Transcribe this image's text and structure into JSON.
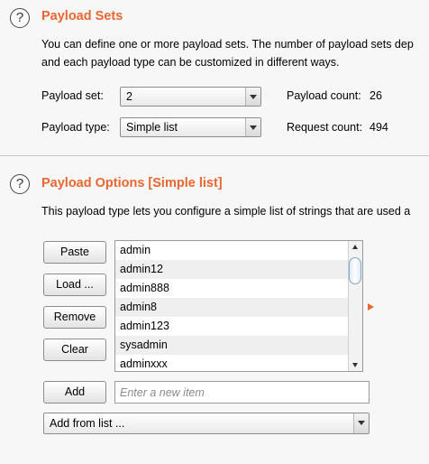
{
  "payload_sets": {
    "title": "Payload Sets",
    "description_line1": "You can define one or more payload sets. The number of payload sets dep",
    "description_line2": "and each payload type can be customized in different ways.",
    "set_label": "Payload set:",
    "set_value": "2",
    "type_label": "Payload type:",
    "type_value": "Simple list",
    "count_label": "Payload count:",
    "count_value": "26",
    "request_label": "Request count:",
    "request_value": "494"
  },
  "payload_options": {
    "title": "Payload Options [Simple list]",
    "description": "This payload type lets you configure a simple list of strings that are used a",
    "buttons": {
      "paste": "Paste",
      "load": "Load ...",
      "remove": "Remove",
      "clear": "Clear",
      "add": "Add"
    },
    "items": [
      "admin",
      "admin12",
      "admin888",
      "admin8",
      "admin123",
      "sysadmin",
      "adminxxx"
    ],
    "new_item_placeholder": "Enter a new item",
    "add_from_list": "Add from list ..."
  },
  "icons": {
    "help": "help-icon",
    "expand": "expand-arrow-icon",
    "accent_color": "#e8662f"
  }
}
